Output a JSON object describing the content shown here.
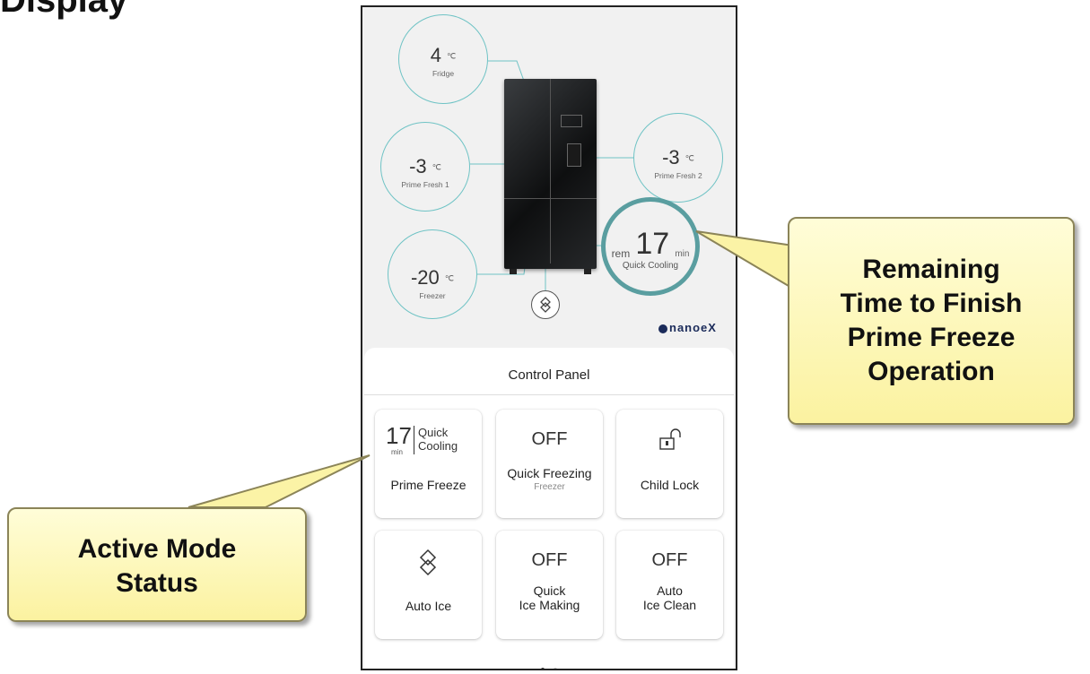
{
  "heading": "Display",
  "fridge": {
    "fridge_temp": "4",
    "fridge_unit": "℃",
    "fridge_label": "Fridge",
    "pf1_temp": "-3",
    "pf1_unit": "℃",
    "pf1_label": "Prime Fresh 1",
    "pf2_temp": "-3",
    "pf2_unit": "℃",
    "pf2_label": "Prime Fresh 2",
    "freezer_temp": "-20",
    "freezer_unit": "℃",
    "freezer_label": "Freezer",
    "quick_cooling": {
      "rem": "rem",
      "value": "17",
      "unit": "min",
      "label": "Quick Cooling"
    },
    "brand": "nanoeX"
  },
  "control_panel": {
    "title": "Control Panel",
    "tiles": [
      {
        "value": "17",
        "unit": "min",
        "status": "Quick\nCooling",
        "name": "Prime Freeze"
      },
      {
        "state": "OFF",
        "name": "Quick Freezing",
        "sub": "Freezer"
      },
      {
        "icon": "unlocked-padlock-icon",
        "name": "Child Lock"
      },
      {
        "icon": "ice-cube-icon",
        "name": "Auto Ice"
      },
      {
        "state": "OFF",
        "name": "Quick\nIce Making"
      },
      {
        "state": "OFF",
        "name": "Auto\nIce Clean"
      }
    ],
    "page_dots": {
      "active_color": "#333333",
      "inactive_color": "#bbbbbb"
    }
  },
  "callouts": {
    "right": "Remaining\nTime to Finish\nPrime Freeze\nOperation",
    "left": "Active Mode\nStatus"
  },
  "colors": {
    "ring": "#5a9ea0",
    "bubble_border": "#6fc3c5",
    "callout_fill": "#fdf7bb",
    "brand": "#1b2b5a"
  }
}
